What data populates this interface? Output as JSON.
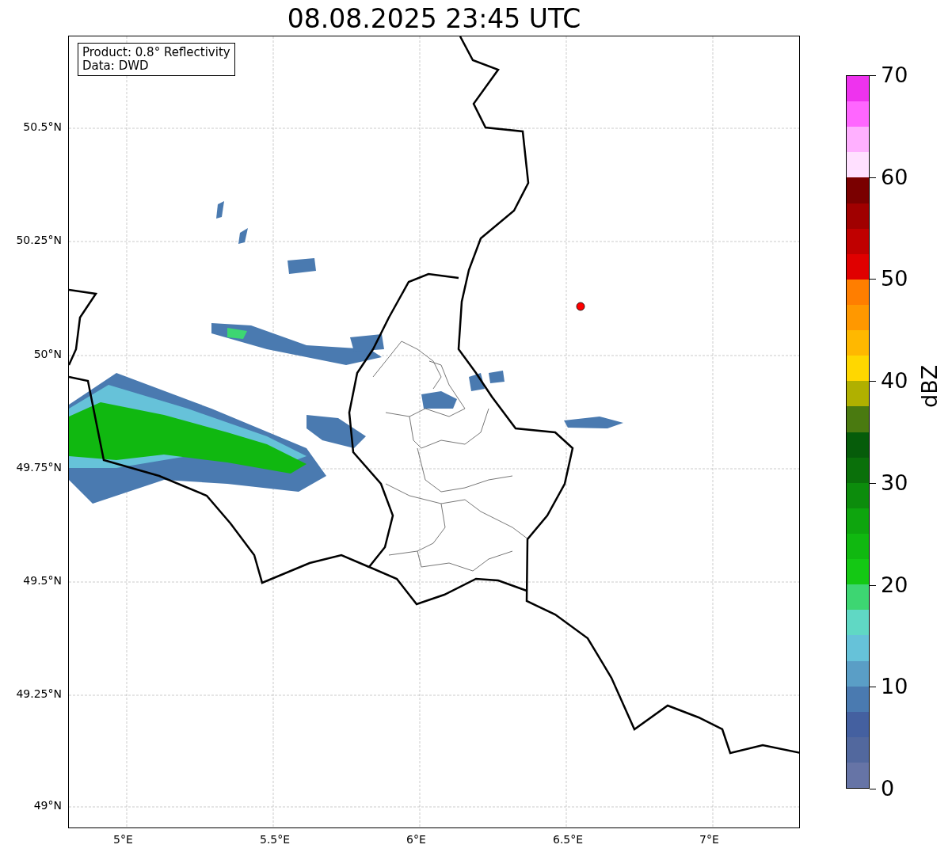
{
  "title": "08.08.2025 23:45 UTC",
  "info_box": {
    "lines": [
      "Product: 0.8° Reflectivity",
      "Data: DWD"
    ]
  },
  "axes": {
    "xticks": [
      "5°E",
      "5.5°E",
      "6°E",
      "6.5°E",
      "7°E"
    ],
    "yticks": [
      "50.5°N",
      "50.25°N",
      "50°N",
      "49.75°N",
      "49.5°N",
      "49.25°N",
      "49°N"
    ]
  },
  "colorbar": {
    "label": "dBZ",
    "ticks": [
      "70",
      "60",
      "50",
      "40",
      "30",
      "20",
      "10",
      "0"
    ],
    "bins": [
      {
        "color": "#ee33ee"
      },
      {
        "color": "#ff66ff"
      },
      {
        "color": "#ffb0ff"
      },
      {
        "color": "#ffe0ff"
      },
      {
        "color": "#7a0000"
      },
      {
        "color": "#a00000"
      },
      {
        "color": "#c00000"
      },
      {
        "color": "#e00000"
      },
      {
        "color": "#ff7e00"
      },
      {
        "color": "#ff9800"
      },
      {
        "color": "#ffb800"
      },
      {
        "color": "#ffd700"
      },
      {
        "color": "#b0b000"
      },
      {
        "color": "#4a7a10"
      },
      {
        "color": "#065c0a"
      },
      {
        "color": "#0a700a"
      },
      {
        "color": "#0c8c0c"
      },
      {
        "color": "#0ea50e"
      },
      {
        "color": "#10b810"
      },
      {
        "color": "#14c814"
      },
      {
        "color": "#3dd672"
      },
      {
        "color": "#60d8c4"
      },
      {
        "color": "#66c2d9"
      },
      {
        "color": "#5a9ec6"
      },
      {
        "color": "#4a7ab0"
      },
      {
        "color": "#4460a0"
      },
      {
        "color": "#52689e"
      },
      {
        "color": "#6674a6"
      }
    ]
  }
}
